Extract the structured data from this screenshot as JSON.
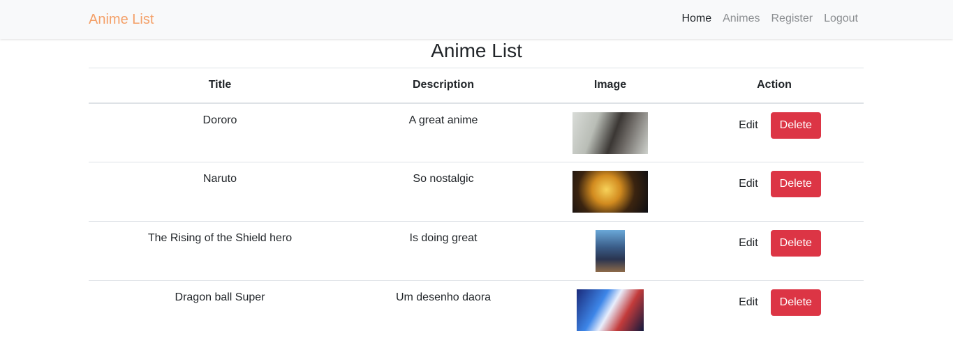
{
  "navbar": {
    "brand": "Anime List",
    "links": [
      "Home",
      "Animes",
      "Register",
      "Logout"
    ],
    "brand_color": "#f4a068"
  },
  "page": {
    "title": "Anime List"
  },
  "table": {
    "headers": [
      "Title",
      "Description",
      "Image",
      "Action"
    ],
    "rows": [
      {
        "title": "Dororo",
        "description": "A great anime",
        "image": "dororo-image"
      },
      {
        "title": "Naruto",
        "description": "So nostalgic",
        "image": "naruto-image"
      },
      {
        "title": "The Rising of the Shield hero",
        "description": "Is doing great",
        "image": "shield-hero-image"
      },
      {
        "title": "Dragon ball Super",
        "description": "Um desenho daora",
        "image": "dragon-ball-super-image"
      }
    ],
    "edit_label": "Edit",
    "delete_label": "Delete",
    "delete_color": "#dc3545"
  }
}
